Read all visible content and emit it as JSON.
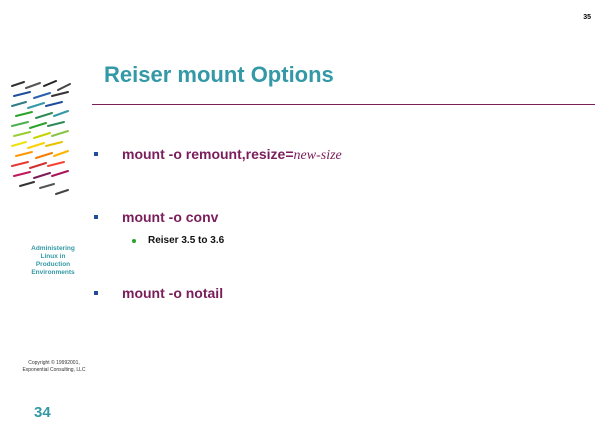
{
  "slide": {
    "page_number": "35",
    "title": "Reiser mount Options",
    "side_title": [
      "Administering",
      "Linux in",
      "Production",
      "Environments"
    ],
    "copyright": [
      "Copyright © 19992001,",
      "Exponential Consulting, LLC"
    ],
    "slide_number": "34",
    "logo_icon": "striped-penguin-logo-icon"
  },
  "bullets": [
    {
      "text": "mount -o remount,resize=",
      "arg": "new-size"
    },
    {
      "text": "mount -o conv",
      "sub": [
        "Reiser 3.5 to 3.6"
      ]
    },
    {
      "text": "mount -o notail"
    }
  ],
  "colors": {
    "title": "#3399a6",
    "bullet_text": "#7a1d5a",
    "rule": "#7a1d5a",
    "bullet_square": "#1f4d99",
    "sub_dot": "#29a329"
  }
}
